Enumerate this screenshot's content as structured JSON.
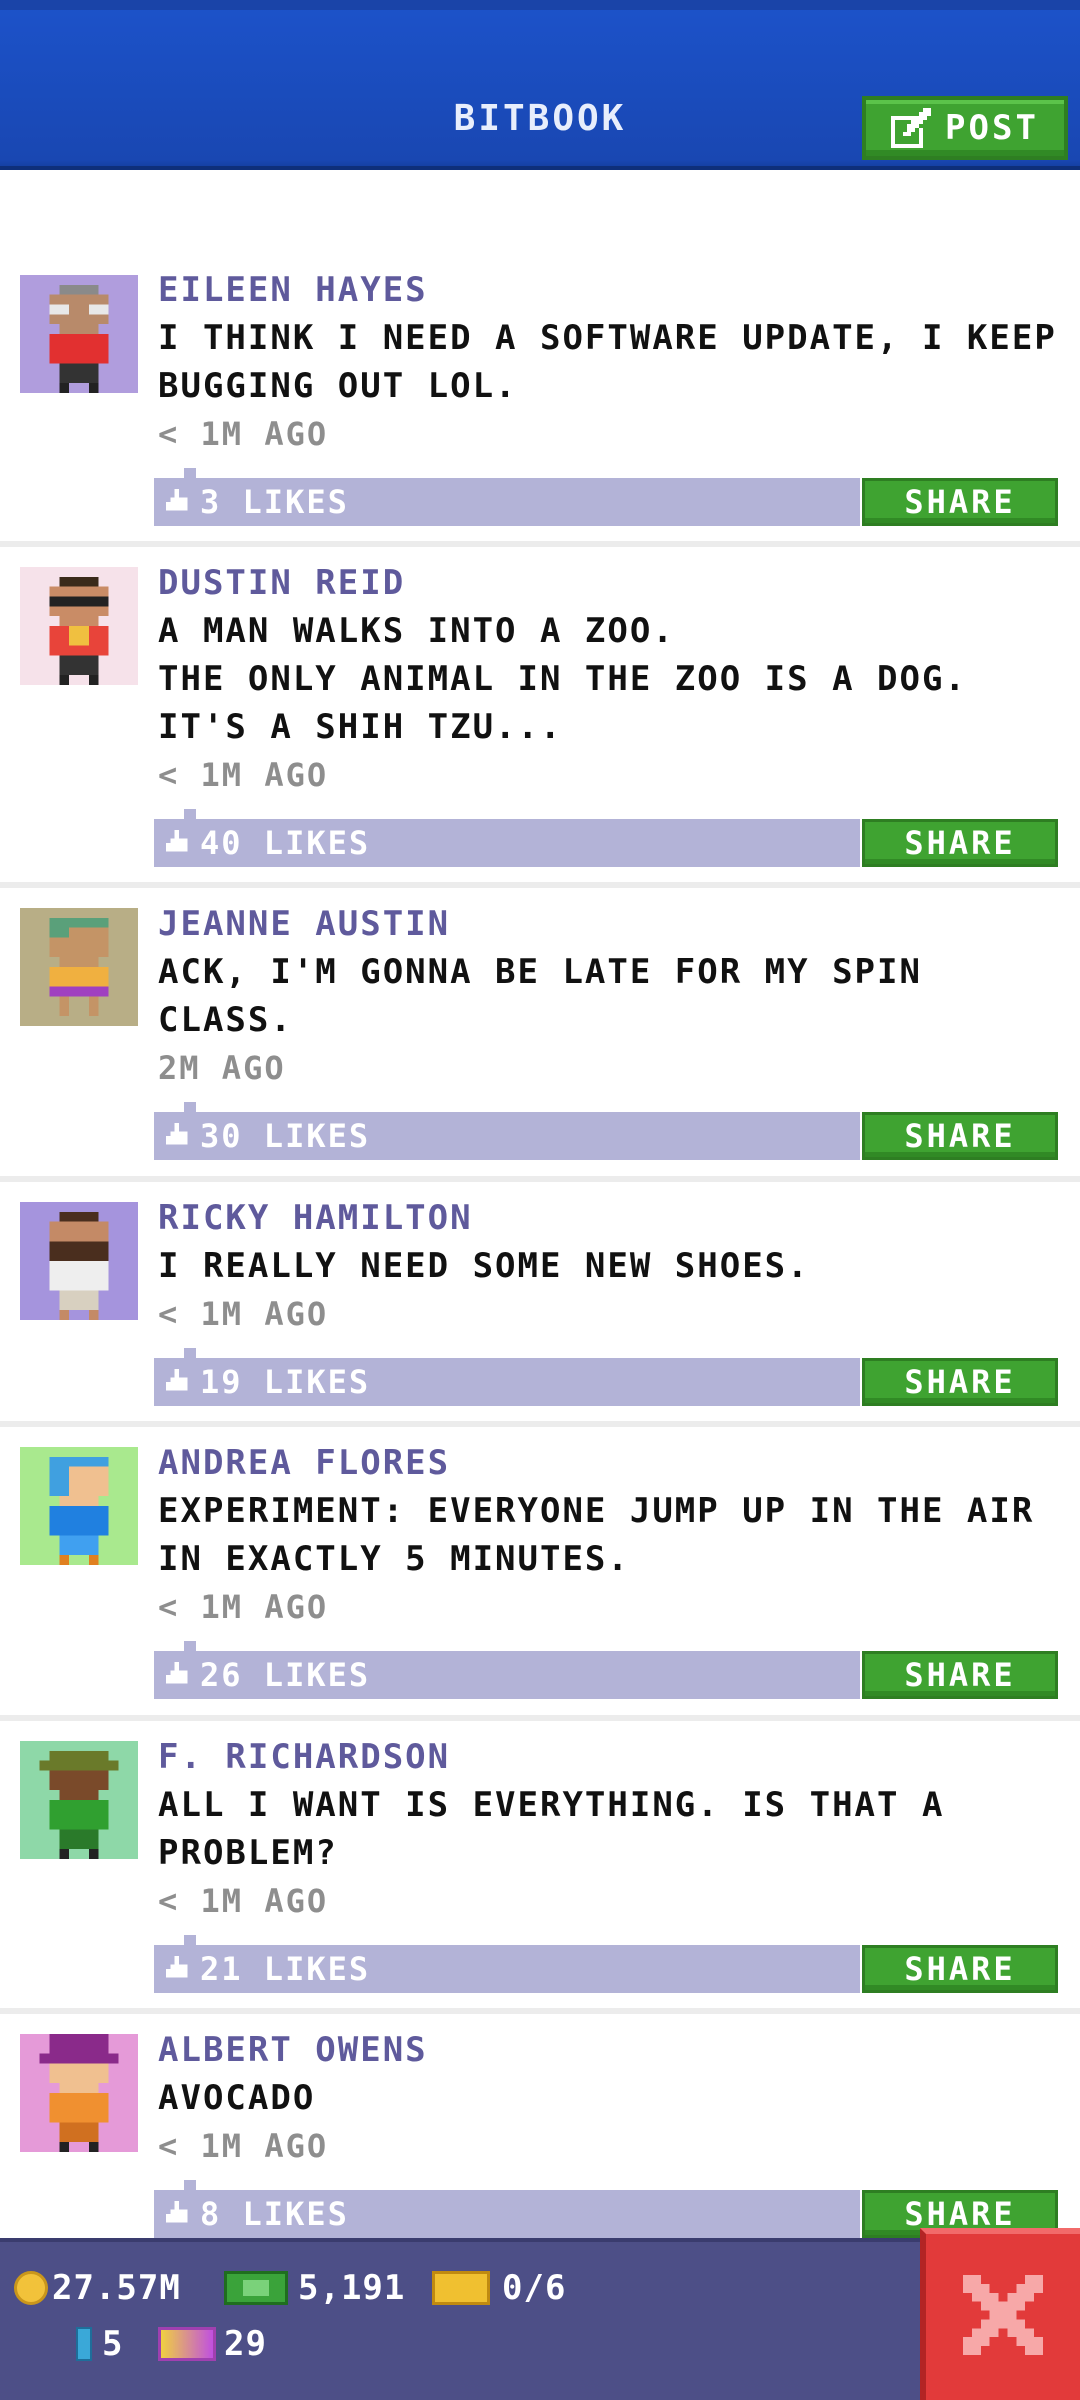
{
  "header": {
    "title": "BITBOOK",
    "post_label": "POST"
  },
  "feed": {
    "posts": [
      {
        "author": "EILEEN HAYES",
        "message": "I THINK I NEED A SOFTWARE UPDATE, I KEEP BUGGING OUT LOL.",
        "time": "< 1M AGO",
        "likes": "3 LIKES",
        "share": "SHARE",
        "avatar_bg": "#b09ddd"
      },
      {
        "author": "DUSTIN REID",
        "message": "A MAN WALKS INTO A ZOO.\nTHE ONLY ANIMAL IN THE ZOO IS A DOG.\nIT'S A SHIH TZU...",
        "time": "< 1M AGO",
        "likes": "40 LIKES",
        "share": "SHARE",
        "avatar_bg": "#f6e2ea"
      },
      {
        "author": "JEANNE AUSTIN",
        "message": "ACK, I'M GONNA BE LATE FOR MY SPIN CLASS.",
        "time": "2M AGO",
        "likes": "30 LIKES",
        "share": "SHARE",
        "avatar_bg": "#b8ae86"
      },
      {
        "author": "RICKY HAMILTON",
        "message": "I REALLY NEED SOME NEW SHOES.",
        "time": "< 1M AGO",
        "likes": "19 LIKES",
        "share": "SHARE",
        "avatar_bg": "#a594dd"
      },
      {
        "author": "ANDREA FLORES",
        "message": "EXPERIMENT: EVERYONE JUMP UP IN THE AIR IN EXACTLY 5 MINUTES.",
        "time": "< 1M AGO",
        "likes": "26 LIKES",
        "share": "SHARE",
        "avatar_bg": "#a9e98e"
      },
      {
        "author": "F. RICHARDSON",
        "message": "ALL I WANT IS EVERYTHING. IS THAT A PROBLEM?",
        "time": "< 1M AGO",
        "likes": "21 LIKES",
        "share": "SHARE",
        "avatar_bg": "#8ed8a8"
      },
      {
        "author": "ALBERT OWENS",
        "message": "AVOCADO",
        "time": "< 1M AGO",
        "likes": "8 LIKES",
        "share": "SHARE",
        "avatar_bg": "#e59ad8"
      }
    ]
  },
  "status": {
    "coins": "27.57M",
    "bux": "5,191",
    "tickets": "0/6",
    "blue_items": "5",
    "golden_tickets": "29"
  },
  "colors": {
    "header_blue": "#1b4cc0",
    "share_green": "#3fa331",
    "likes_bar": "#b3b3d7",
    "author_purple": "#5f5a9c",
    "statusbar": "#4d4f87",
    "close_red": "#e23a3a"
  }
}
